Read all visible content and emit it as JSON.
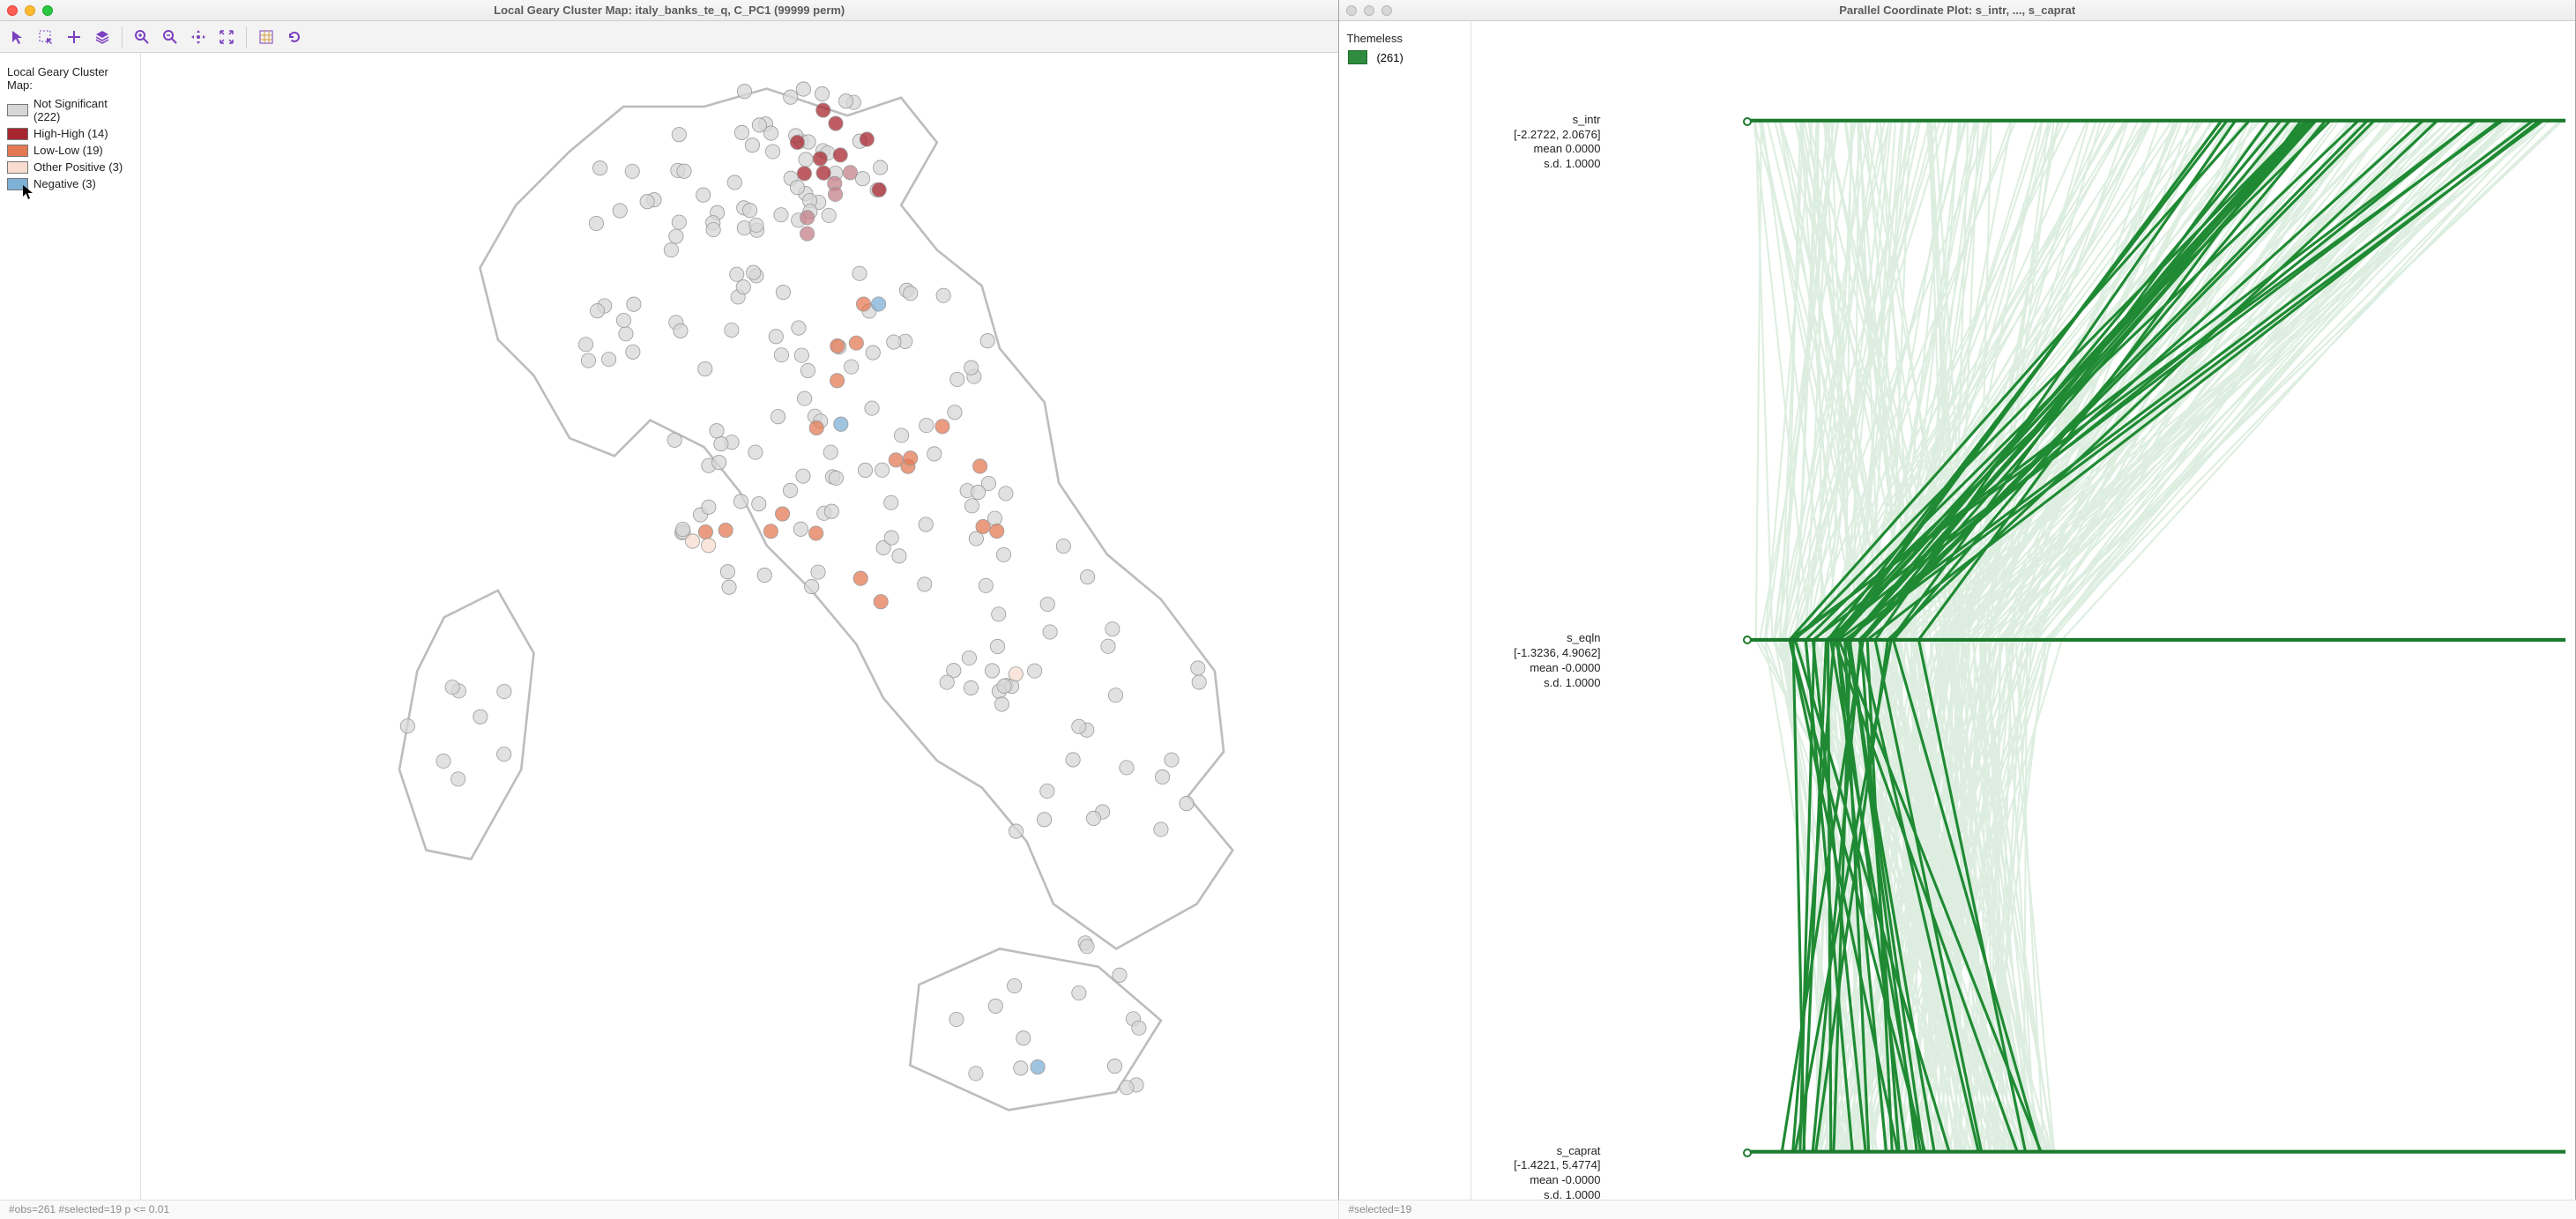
{
  "left_window": {
    "title": "Local Geary Cluster Map: italy_banks_te_q, C_PC1 (99999 perm)",
    "toolbar_icons": [
      "select-arrow-icon",
      "select-box-icon",
      "pan-plus-icon",
      "layers-icon",
      "zoom-in-icon",
      "zoom-out-icon",
      "fit-move-icon",
      "fit-extent-icon",
      "basemap-icon",
      "refresh-icon"
    ],
    "legend": {
      "title": "Local Geary Cluster Map:",
      "items": [
        {
          "label": "Not Significant (222)",
          "color": "#d7d7d7"
        },
        {
          "label": "High-High (14)",
          "color": "#a8262f"
        },
        {
          "label": "Low-Low (19)",
          "color": "#e47a54"
        },
        {
          "label": "Other Positive (3)",
          "color": "#f7dccf"
        },
        {
          "label": "Negative (3)",
          "color": "#7fb0d6"
        }
      ]
    },
    "status": "#obs=261 #selected=19   p <= 0.01"
  },
  "right_window": {
    "title": "Parallel Coordinate Plot: s_intr, ..., s_caprat",
    "theme": {
      "title": "Themeless",
      "count_label": "(261)",
      "color": "#2e8b3f"
    },
    "axes": [
      {
        "name": "s_intr",
        "range": "[-2.2722, 2.0676]",
        "mean": "mean  0.0000",
        "sd": "s.d.  1.0000",
        "yPct": 8.5
      },
      {
        "name": "s_eqln",
        "range": "[-1.3236, 4.9062]",
        "mean": "mean  -0.0000",
        "sd": "s.d.  1.0000",
        "yPct": 52.5
      },
      {
        "name": "s_caprat",
        "range": "[-1.4221, 5.4774]",
        "mean": "mean  -0.0000",
        "sd": "s.d.  1.0000",
        "yPct": 96
      }
    ],
    "status": "#selected=19"
  },
  "chart_data": {
    "type": "map+parallel",
    "map": {
      "categories": [
        "Not Significant",
        "High-High",
        "Low-Low",
        "Other Positive",
        "Negative"
      ],
      "counts": [
        222,
        14,
        19,
        3,
        3
      ],
      "total_obs": 261,
      "selected": 19,
      "p_threshold": 0.01
    },
    "parallel": {
      "variables": [
        {
          "name": "s_intr",
          "min": -2.2722,
          "max": 2.0676,
          "mean": 0.0,
          "sd": 1.0
        },
        {
          "name": "s_eqln",
          "min": -1.3236,
          "max": 4.9062,
          "mean": 0.0,
          "sd": 1.0
        },
        {
          "name": "s_caprat",
          "min": -1.4221,
          "max": 5.4774,
          "mean": 0.0,
          "sd": 1.0
        }
      ],
      "n": 261,
      "selected": 19
    }
  }
}
